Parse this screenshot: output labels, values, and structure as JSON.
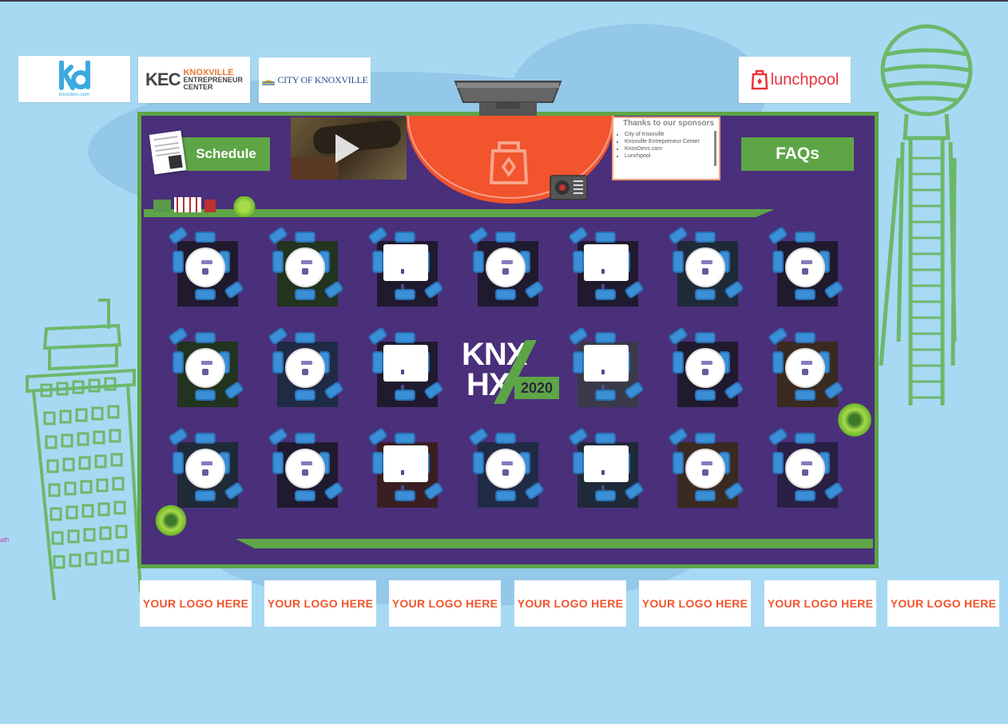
{
  "sponsor_logos_top": [
    {
      "id": "knoxdevs",
      "text": "knoxdevs.com"
    },
    {
      "id": "kec",
      "main": "KEC",
      "line1": "KNOXVILLE",
      "line2": "ENTREPRENEUR",
      "line3": "CENTER"
    },
    {
      "id": "city",
      "text": "CITY OF KNOXVILLE"
    },
    {
      "id": "lunchpool",
      "text": "lunchpool"
    }
  ],
  "room": {
    "schedule_label": "Schedule",
    "faqs_label": "FAQs",
    "event_logo": {
      "line1": "KNX",
      "line2": "HX",
      "year": "2020"
    },
    "notice_board": {
      "title": "Thanks to our sponsors",
      "items": [
        "City of Knoxville",
        "Knoxville Entrepreneur Center",
        "KnoxDevs.com",
        "Lunchpool"
      ]
    }
  },
  "sponsor_slots": [
    "YOUR LOGO HERE",
    "YOUR LOGO HERE",
    "YOUR LOGO HERE",
    "YOUR LOGO HERE",
    "YOUR LOGO HERE",
    "YOUR LOGO HERE",
    "YOUR LOGO HERE"
  ],
  "side_text": "ath",
  "colors": {
    "sky": "#a8d9f2",
    "room": "#4a2f7a",
    "green": "#5ea547",
    "orange": "#f2542d",
    "chair": "#3a8fd6"
  }
}
